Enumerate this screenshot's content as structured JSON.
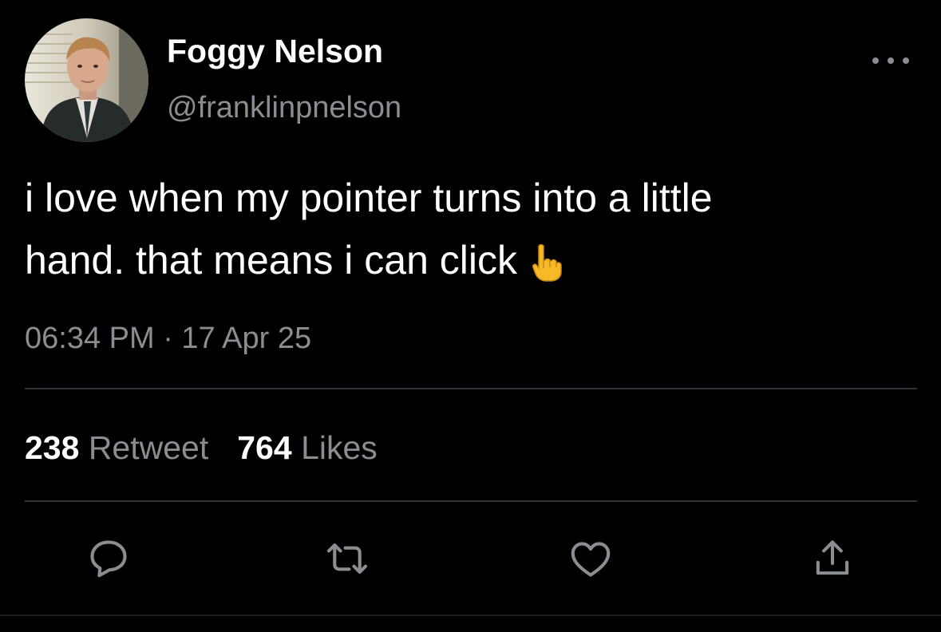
{
  "tweet": {
    "display_name": "Foggy Nelson",
    "handle": "@franklinpnelson",
    "text_line1": "i love when my pointer turns into a little",
    "text_line2": "hand. that means i can click",
    "emoji": "pointing-hand-emoji",
    "timestamp": "06:34 PM · 17 Apr 25"
  },
  "stats": {
    "retweets_count": "238",
    "retweets_label": "Retweet",
    "likes_count": "764",
    "likes_label": "Likes"
  },
  "actions": {
    "icons": [
      "reply-icon",
      "retweet-icon",
      "like-icon",
      "share-icon"
    ]
  },
  "colors": {
    "background": "#000000",
    "primary_text": "#ffffff",
    "secondary_text": "#8a8d91",
    "divider": "#2f3336",
    "emoji": "#f7b928"
  }
}
